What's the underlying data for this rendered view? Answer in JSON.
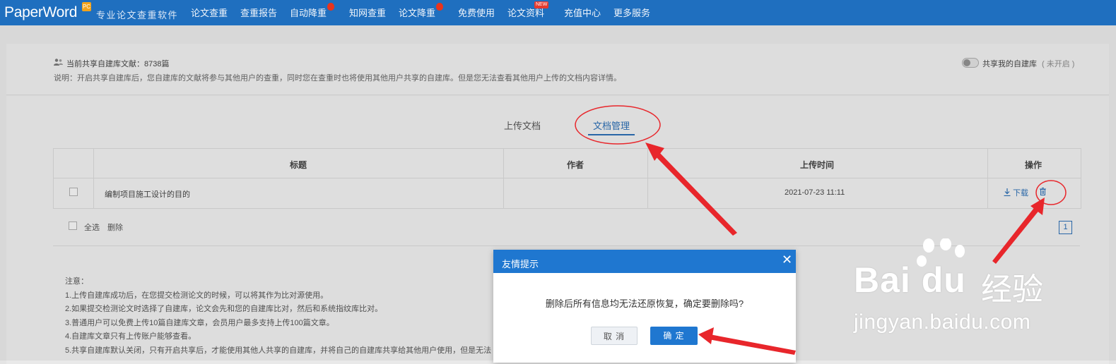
{
  "nav": {
    "logo": "PaperWord",
    "logo_badge": "PC",
    "slogan": "专业论文查重软件",
    "items": [
      "论文查重",
      "查重报告",
      "自动降重",
      "知网查重",
      "论文降重",
      "免费使用",
      "论文资料",
      "充值中心",
      "更多服务"
    ],
    "new_badge": "NEW"
  },
  "info": {
    "shared_count_label": "当前共享自建库文献：8738篇",
    "description": "说明：开启共享自建库后，您自建库的文献将参与其他用户的查重，同时您在查重时也将使用其他用户共享的自建库。但是您无法查看其他用户上传的文档内容详情。",
    "toggle_label": "共享我的自建库",
    "toggle_status": "( 未开启 )"
  },
  "tabs": {
    "upload": "上传文档",
    "manage": "文档管理"
  },
  "table": {
    "headers": {
      "title": "标题",
      "author": "作者",
      "upload_time": "上传时间",
      "actions": "操作"
    },
    "rows": [
      {
        "title": "编制项目施工设计的目的",
        "author": "",
        "upload_time": "2021-07-23 11:11",
        "download": "下载"
      }
    ],
    "select_all": "全选",
    "delete": "删除",
    "page": "1"
  },
  "notes": {
    "heading": "注意：",
    "lines": [
      "1.上传自建库成功后，在您提交检测论文的时候，可以将其作为比对源使用。",
      "2.如果提交检测论文时选择了自建库，论文会先和您的自建库比对，然后和系统指纹库比对。",
      "3.普通用户可以免费上传10篇自建库文章，会员用户最多支持上传100篇文章。",
      "4.自建库文章只有上传账户能够查看。",
      "5.共享自建库默认关闭，只有开启共享后，才能使用其他人共享的自建库，并将自己的自建库共享给其他用户使用，但是无法"
    ]
  },
  "dialog": {
    "title": "友情提示",
    "message": "删除后所有信息均无法还原恢复，确定要删除吗?",
    "cancel": "取 消",
    "confirm": "确 定"
  },
  "watermark": {
    "brand": "Bai du",
    "cn": "经验",
    "url": "jingyan.baidu.com"
  },
  "colors": {
    "nav_bg": "#1f6fbf",
    "accent": "#1f77d0",
    "annotation_red": "#e8262b"
  }
}
